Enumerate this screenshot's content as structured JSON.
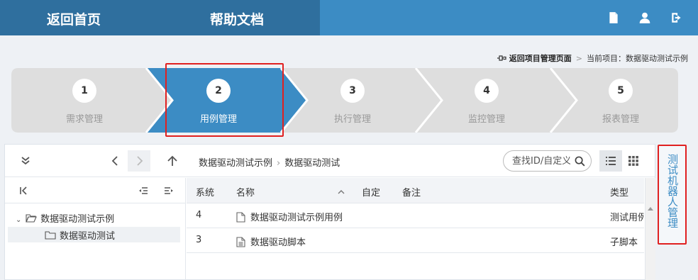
{
  "header": {
    "home_label": "返回首页",
    "help_label": "帮助文档",
    "icons": [
      "document-icon",
      "user-icon",
      "logout-icon"
    ]
  },
  "project_bar": {
    "back_label": "返回项目管理页面",
    "current_label": "当前项目：",
    "current_project": "数据驱动测试示例"
  },
  "steps": [
    {
      "number": "1",
      "label": "需求管理",
      "active": false
    },
    {
      "number": "2",
      "label": "用例管理",
      "active": true
    },
    {
      "number": "3",
      "label": "执行管理",
      "active": false
    },
    {
      "number": "4",
      "label": "监控管理",
      "active": false
    },
    {
      "number": "5",
      "label": "报表管理",
      "active": false
    }
  ],
  "side_tab": {
    "label": "测试机器人管理"
  },
  "toolbar": {
    "breadcrumb": [
      "数据驱动测试示例",
      "数据驱动测试"
    ],
    "search_placeholder": "查找ID/自定义ID"
  },
  "tree": {
    "items": [
      {
        "label": "数据驱动测试示例",
        "expanded": true
      },
      {
        "label": "数据驱动测试",
        "selected": true
      }
    ]
  },
  "table": {
    "columns": [
      "系统",
      "名称",
      "自定",
      "备注",
      "类型"
    ],
    "rows": [
      {
        "system": "4",
        "name": "数据驱动测试示例用例",
        "custom": "",
        "note": "",
        "type": "测试用例"
      },
      {
        "system": "3",
        "name": "数据驱动脚本",
        "custom": "",
        "note": "",
        "type": "子脚本"
      }
    ]
  },
  "colors": {
    "accent": "#3c8cc4",
    "header_dark": "#2f6f9e",
    "highlight": "#e02020",
    "step_inactive": "#dedede"
  }
}
